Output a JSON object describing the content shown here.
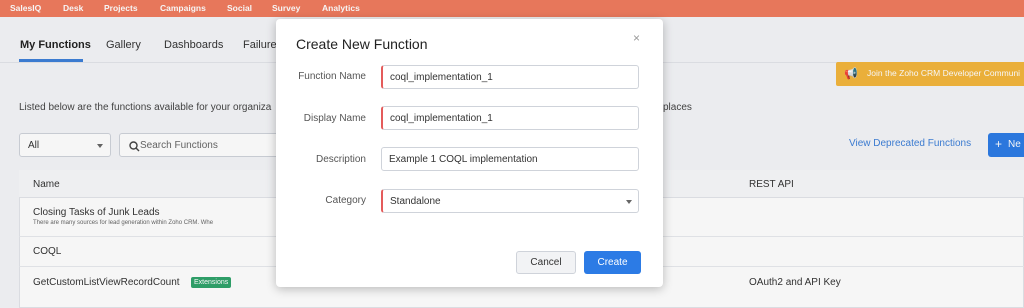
{
  "topnav": {
    "items": [
      "SalesIQ",
      "Desk",
      "Projects",
      "Campaigns",
      "Social",
      "Survey",
      "Analytics"
    ]
  },
  "tabs": [
    "My Functions",
    "Gallery",
    "Dashboards",
    "Failure"
  ],
  "banner": {
    "text": "Join the Zoho CRM Developer Communi",
    "icon": "megaphone-icon"
  },
  "description": {
    "text": "Listed below are the functions available for your organiza",
    "tail": "places"
  },
  "filter": {
    "selected": "All"
  },
  "search": {
    "placeholder": "Search Functions"
  },
  "actions": {
    "deprecated_label": "View Deprecated Functions",
    "new_label": "Ne"
  },
  "table": {
    "columns": {
      "name": "Name",
      "rest_api": "REST API"
    },
    "rows": [
      {
        "name": "Closing Tasks of Junk Leads",
        "description": "There are many sources for lead generation within Zoho CRM. Whe",
        "rest_api": ""
      },
      {
        "name": "COQL",
        "rest_api": ""
      },
      {
        "name": "GetCustomListViewRecordCount",
        "badge": "Extensions",
        "rest_api": "OAuth2 and API Key"
      }
    ]
  },
  "modal": {
    "title": "Create New Function",
    "close_symbol": "×",
    "fields": {
      "function_name": {
        "label": "Function Name",
        "value": "coql_implementation_1"
      },
      "display_name": {
        "label": "Display Name",
        "value": "coql_implementation_1"
      },
      "description": {
        "label": "Description",
        "value": "Example 1 COQL implementation"
      },
      "category": {
        "label": "Category",
        "value": "Standalone"
      }
    },
    "cancel_label": "Cancel",
    "create_label": "Create"
  },
  "colors": {
    "topnav": "#f07b5e",
    "accent": "#2c7be5",
    "required": "#e45b5b",
    "banner": "#f3b63c",
    "badge": "#2fa36b"
  }
}
